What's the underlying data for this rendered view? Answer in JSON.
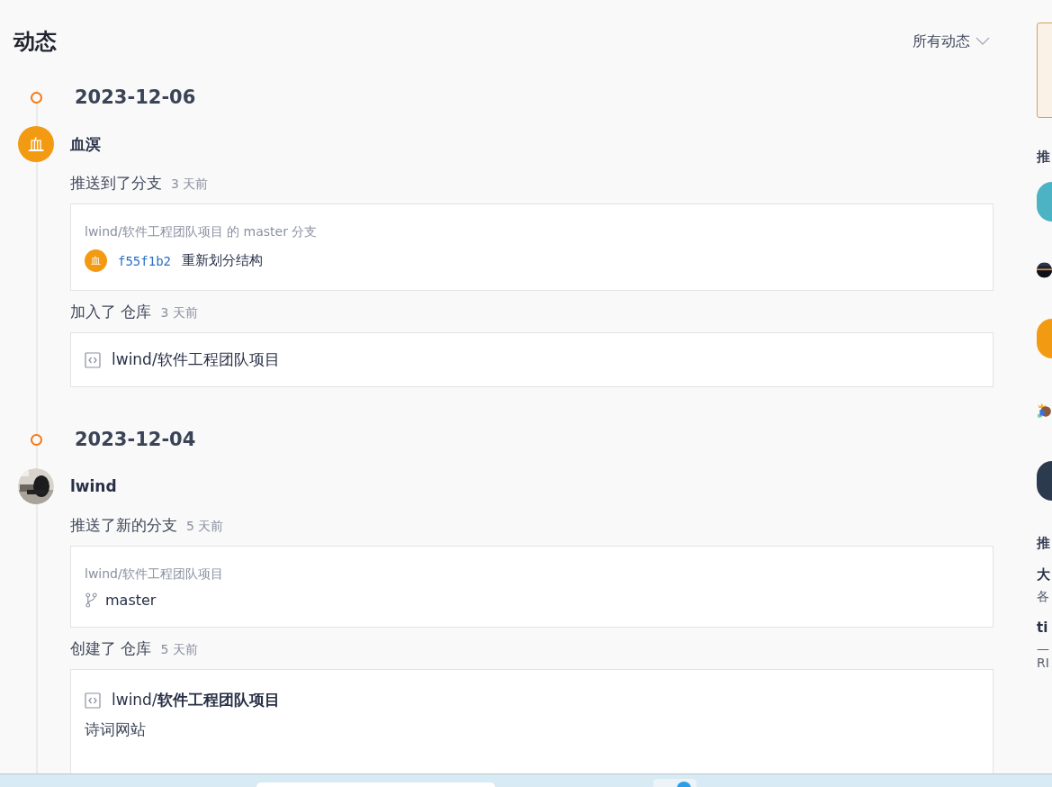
{
  "header": {
    "title": "动态",
    "filter": "所有动态"
  },
  "groups": [
    {
      "date": "2023-12-06",
      "user": {
        "name": "血溟",
        "kind": "letter",
        "avatar_text": "血"
      },
      "events": [
        {
          "kind": "commit",
          "action": "推送到了分支",
          "time": "3 天前",
          "repo_line": "lwind/软件工程团队项目 的 master 分支",
          "commits": [
            {
              "avatar_text": "血",
              "sha": "f55f1b2",
              "message": "重新划分结构"
            }
          ]
        },
        {
          "kind": "repo",
          "action": "加入了 仓库",
          "time": "3 天前",
          "repo": "lwind/软件工程团队项目"
        }
      ]
    },
    {
      "date": "2023-12-04",
      "user": {
        "name": "lwind",
        "kind": "picture"
      },
      "events": [
        {
          "kind": "branch",
          "action": "推送了新的分支",
          "time": "5 天前",
          "repo_line": "lwind/软件工程团队项目",
          "branch": "master"
        },
        {
          "kind": "created",
          "action": "创建了 仓库",
          "time": "5 天前",
          "repo": "lwind/**软件工程团队项目**",
          "description": "诗词网站"
        }
      ]
    }
  ],
  "sidebar": {
    "heading_1": "推",
    "avatars": [
      {
        "kind": "plain",
        "color": "#4bb3c4"
      },
      {
        "kind": "picture"
      },
      {
        "kind": "plain",
        "color": "#f29b12"
      },
      {
        "kind": "crown"
      },
      {
        "kind": "plain",
        "color": "#2c3a4e"
      }
    ],
    "heading_2": "推",
    "items": [
      {
        "title": "大",
        "text": "各"
      },
      {
        "title": "ti",
        "text": "—"
      }
    ],
    "last_text": "RI"
  }
}
